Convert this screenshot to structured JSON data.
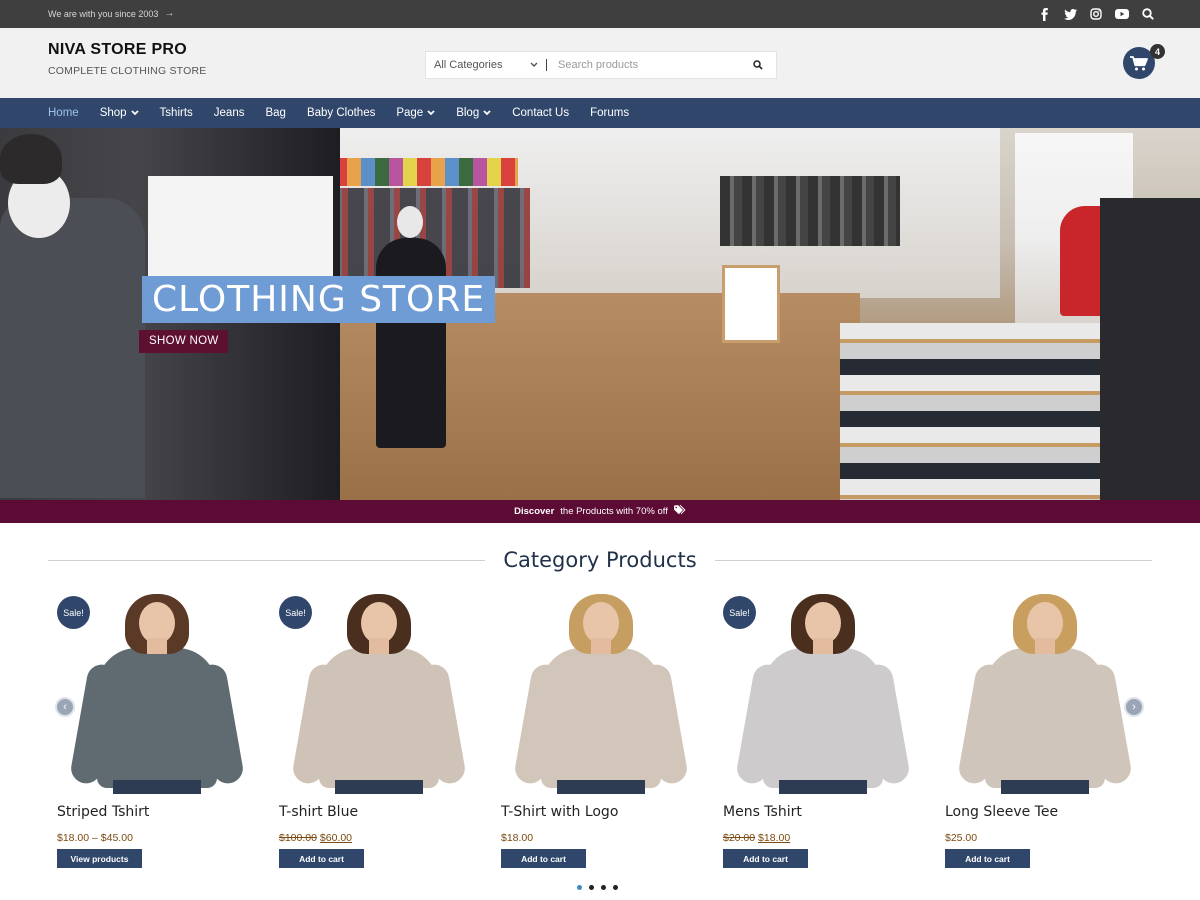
{
  "topbar": {
    "tagline": "We are with you since 2003",
    "social_icons": [
      "facebook-icon",
      "twitter-icon",
      "instagram-icon",
      "youtube-icon",
      "search-icon"
    ]
  },
  "header": {
    "brand_title": "NIVA STORE PRO",
    "brand_subtitle": "COMPLETE CLOTHING STORE",
    "category_select": "All Categories",
    "search_placeholder": "Search products",
    "cart_count": "4"
  },
  "nav": {
    "items": [
      {
        "label": "Home",
        "active": true,
        "dropdown": false
      },
      {
        "label": "Shop",
        "active": false,
        "dropdown": true
      },
      {
        "label": "Tshirts",
        "active": false,
        "dropdown": false
      },
      {
        "label": "Jeans",
        "active": false,
        "dropdown": false
      },
      {
        "label": "Bag",
        "active": false,
        "dropdown": false
      },
      {
        "label": "Baby Clothes",
        "active": false,
        "dropdown": false
      },
      {
        "label": "Page",
        "active": false,
        "dropdown": true
      },
      {
        "label": "Blog",
        "active": false,
        "dropdown": true
      },
      {
        "label": "Contact Us",
        "active": false,
        "dropdown": false
      },
      {
        "label": "Forums",
        "active": false,
        "dropdown": false
      }
    ]
  },
  "hero": {
    "title": "CLOTHING STORE",
    "button": "SHOW NOW"
  },
  "discover": {
    "bold": "Discover",
    "text": "the Products with 70% off"
  },
  "section": {
    "title": "Category Products"
  },
  "products": [
    {
      "name": "Striped Tshirt",
      "sale": true,
      "sale_label": "Sale!",
      "old_price": "",
      "price": "$18.00 – $45.00",
      "button": "View products",
      "top_color": "#5f6b70",
      "hair_color": "#5a3a26"
    },
    {
      "name": "T-shirt Blue",
      "sale": true,
      "sale_label": "Sale!",
      "old_price": "$100.00",
      "price": "$60.00",
      "button": "Add to cart",
      "top_color": "#cfc3b7",
      "hair_color": "#4a2f1f"
    },
    {
      "name": "T-Shirt with Logo",
      "sale": false,
      "sale_label": "",
      "old_price": "",
      "price": "$18.00",
      "button": "Add to cart",
      "top_color": "#d2c6ba",
      "hair_color": "#c79e62"
    },
    {
      "name": "Mens Tshirt",
      "sale": true,
      "sale_label": "Sale!",
      "old_price": "$20.00",
      "price": "$18.00",
      "button": "Add to cart",
      "top_color": "#cdcbcb",
      "hair_color": "#4a2f1f"
    },
    {
      "name": "Long Sleeve Tee",
      "sale": false,
      "sale_label": "",
      "old_price": "",
      "price": "$25.00",
      "button": "Add to cart",
      "top_color": "#d0c5bb",
      "hair_color": "#c99f5f"
    }
  ],
  "carousel": {
    "dots": 4,
    "active_dot": 0
  },
  "colors": {
    "primary": "#30476b",
    "accent": "#5c0b34",
    "hero_title_bg": "#6f9cd4",
    "topbar": "#3f3f3f"
  }
}
